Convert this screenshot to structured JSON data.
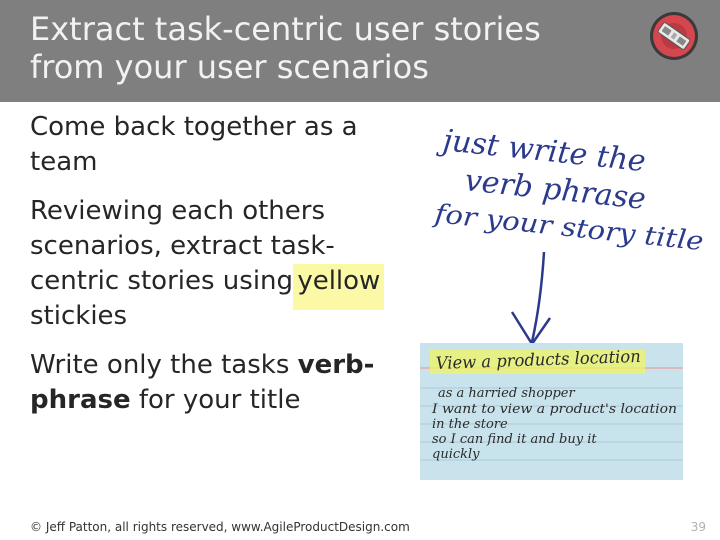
{
  "slide": {
    "title_line1": "Extract task-centric user stories",
    "title_line2": "from your user scenarios",
    "bullets": {
      "b1": "Come back together as a team",
      "b2_pre": "Reviewing each others scenarios, extract task-centric stories using ",
      "b2_highlight": "yellow",
      "b2_post": " stickies",
      "b3_pre": "Write only the tasks ",
      "b3_bold": "verb-phrase",
      "b3_post": " for your title"
    },
    "annotation": {
      "line1": "just write the",
      "line2": "verb phrase",
      "line3": "for your story title"
    },
    "card": {
      "title": "View a products location",
      "line1": "as a harried shopper",
      "line2": "I want to view a product's location",
      "line3": "in the store",
      "line4": "so I can find it and buy it",
      "line5": "quickly"
    },
    "footer": "© Jeff Patton, all rights reserved, www.AgileProductDesign.com",
    "page_number": "39"
  },
  "colors": {
    "header_bg": "#7f7f7f",
    "highlight": "#fbf8a6",
    "ink": "#2b3a8c",
    "card": "#c9e3ec"
  }
}
